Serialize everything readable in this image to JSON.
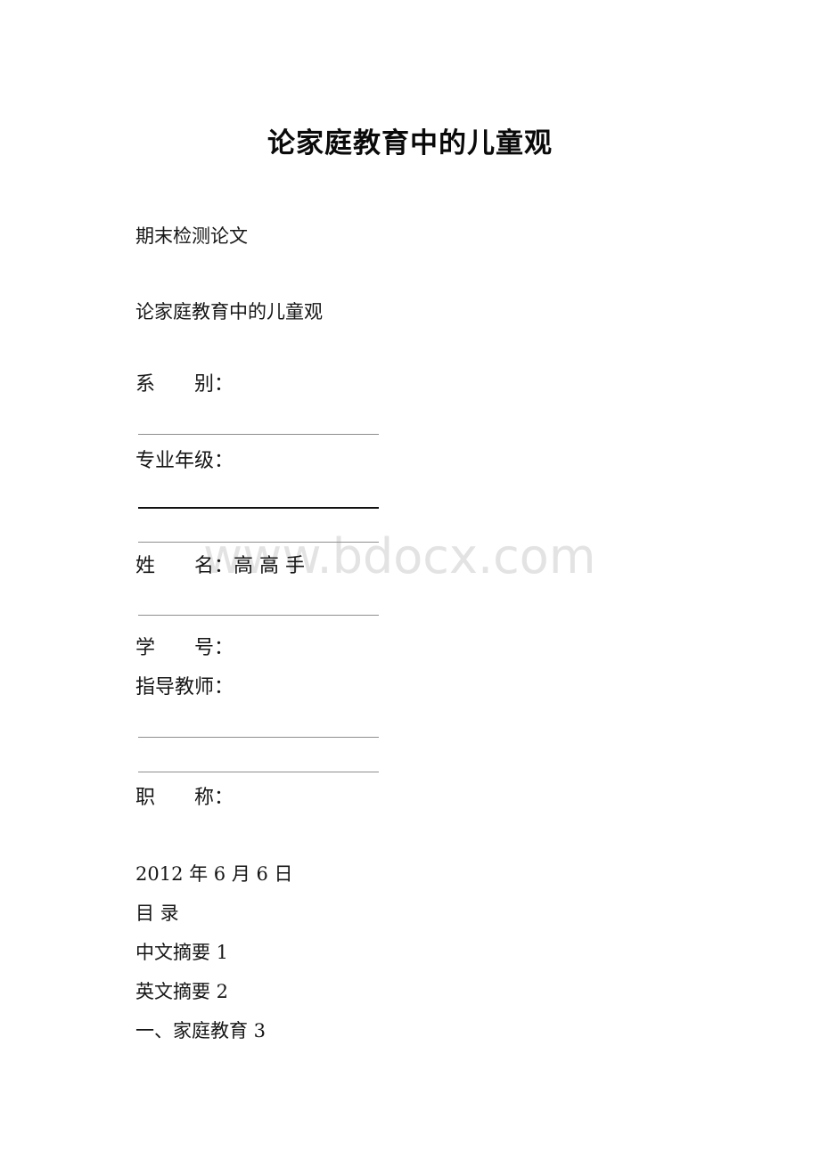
{
  "document": {
    "title": "论家庭教育中的儿童观",
    "watermark": "www.bdocx.com",
    "subtitle_label": "期末检测论文",
    "paper_title": "论家庭教育中的儿童观",
    "cover_fields": [
      {
        "label": "系　　别：",
        "value": ""
      },
      {
        "label": "专业年级：",
        "value": ""
      },
      {
        "label": "姓　　名：",
        "value": "高 高 手"
      },
      {
        "label": "学　　号：",
        "value": ""
      },
      {
        "label": "指导教师：",
        "value": ""
      },
      {
        "label": "职　　称：",
        "value": ""
      }
    ],
    "date": "2012 年 6 月 6 日",
    "toc_heading": "目 录",
    "toc_entries": [
      {
        "text": "中文摘要 1"
      },
      {
        "text": "英文摘要 2"
      },
      {
        "text": "一、家庭教育 3"
      }
    ]
  }
}
